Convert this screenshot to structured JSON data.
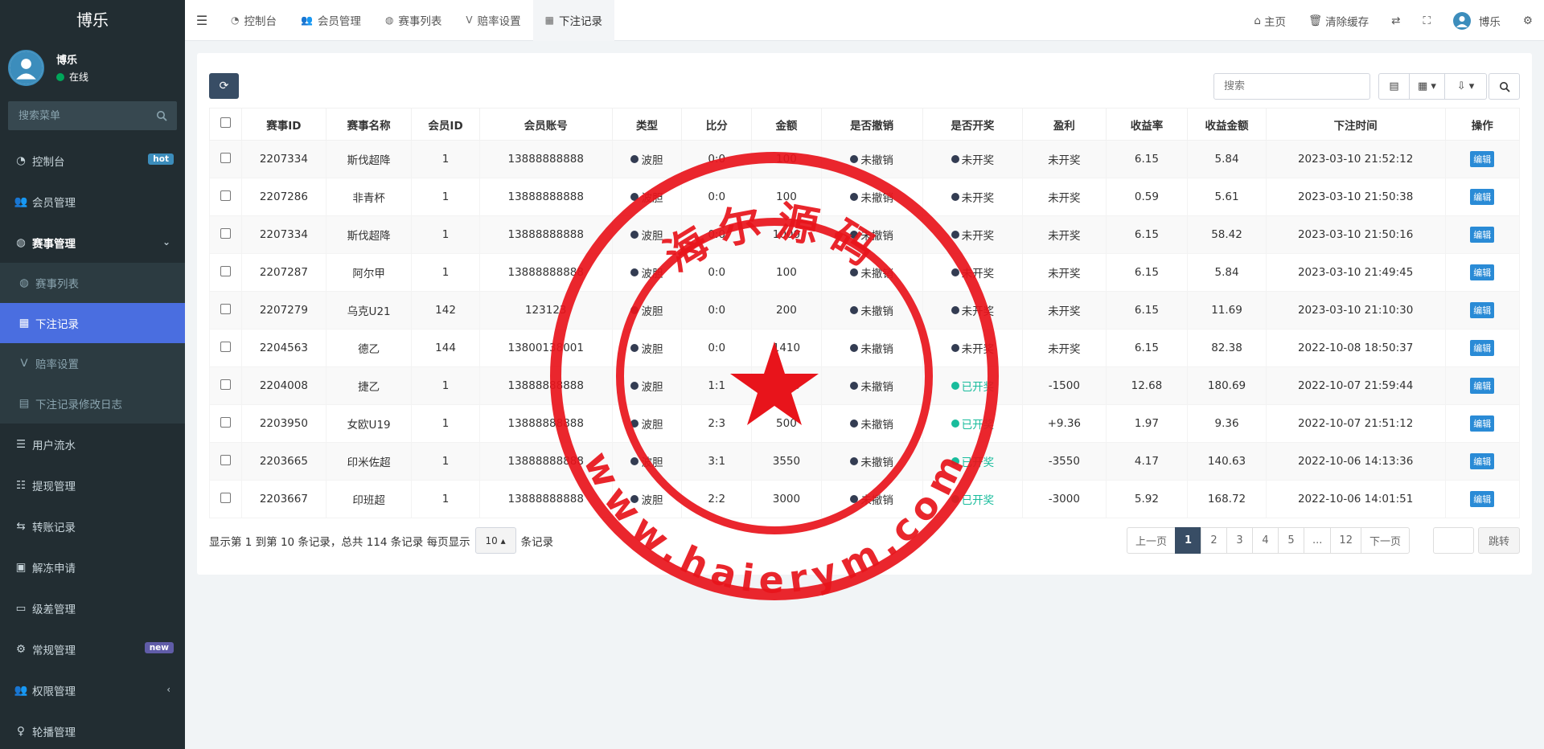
{
  "sidebar": {
    "brand": "博乐",
    "user": {
      "name": "博乐",
      "status": "在线"
    },
    "search_placeholder": "搜索菜单",
    "items": [
      {
        "label": "控制台",
        "icon": "dashboard-icon",
        "badge": "hot"
      },
      {
        "label": "会员管理",
        "icon": "users-icon"
      },
      {
        "label": "赛事管理",
        "icon": "globe-icon",
        "arrow": "⌄"
      },
      {
        "label": "赛事列表",
        "icon": "globe-icon"
      },
      {
        "label": "下注记录",
        "icon": "calendar-icon"
      },
      {
        "label": "赔率设置",
        "icon": "vk-icon"
      },
      {
        "label": "下注记录修改日志",
        "icon": "list-icon"
      },
      {
        "label": "用户流水",
        "icon": "bars-icon"
      },
      {
        "label": "提现管理",
        "icon": "list-ol-icon"
      },
      {
        "label": "转账记录",
        "icon": "transfer-icon"
      },
      {
        "label": "解冻申请",
        "icon": "picture-icon"
      },
      {
        "label": "级差管理",
        "icon": "window-icon"
      },
      {
        "label": "常规管理",
        "icon": "cogs-icon",
        "badge": "new"
      },
      {
        "label": "权限管理",
        "icon": "users-icon",
        "arrow": "‹"
      },
      {
        "label": "轮播管理",
        "icon": "venus-icon"
      }
    ]
  },
  "topbar": {
    "tabs": [
      {
        "label": "控制台",
        "icon": "dashboard-icon"
      },
      {
        "label": "会员管理",
        "icon": "users-icon"
      },
      {
        "label": "赛事列表",
        "icon": "globe-icon"
      },
      {
        "label": "赔率设置",
        "icon": "vk-icon"
      },
      {
        "label": "下注记录",
        "icon": "calendar-icon"
      }
    ],
    "right": {
      "home": "主页",
      "clear_cache": "清除缓存",
      "username": "博乐"
    }
  },
  "toolbar": {
    "search_placeholder": "搜索"
  },
  "table": {
    "headers": [
      "赛事ID",
      "赛事名称",
      "会员ID",
      "会员账号",
      "类型",
      "比分",
      "金额",
      "是否撤销",
      "是否开奖",
      "盈利",
      "收益率",
      "收益金额",
      "下注时间",
      "操作"
    ],
    "rows": [
      [
        "2207334",
        "斯伐超降",
        "1",
        "13888888888",
        "波胆",
        "0:0",
        "100",
        "未撤销",
        "未开奖",
        "未开奖",
        "6.15",
        "5.84",
        "2023-03-10 21:52:12",
        "编辑"
      ],
      [
        "2207286",
        "非青杯",
        "1",
        "13888888888",
        "波胆",
        "0:0",
        "100",
        "未撤销",
        "未开奖",
        "未开奖",
        "0.59",
        "5.61",
        "2023-03-10 21:50:38",
        "编辑"
      ],
      [
        "2207334",
        "斯伐超降",
        "1",
        "13888888888",
        "波胆",
        "0:0",
        "1000",
        "未撤销",
        "未开奖",
        "未开奖",
        "6.15",
        "58.42",
        "2023-03-10 21:50:16",
        "编辑"
      ],
      [
        "2207287",
        "阿尔甲",
        "1",
        "13888888888",
        "波胆",
        "0:0",
        "100",
        "未撤销",
        "未开奖",
        "未开奖",
        "6.15",
        "5.84",
        "2023-03-10 21:49:45",
        "编辑"
      ],
      [
        "2207279",
        "乌克U21",
        "142",
        "123123",
        "波胆",
        "0:0",
        "200",
        "未撤销",
        "未开奖",
        "未开奖",
        "6.15",
        "11.69",
        "2023-03-10 21:10:30",
        "编辑"
      ],
      [
        "2204563",
        "德乙",
        "144",
        "13800138001",
        "波胆",
        "0:0",
        "1410",
        "未撤销",
        "未开奖",
        "未开奖",
        "6.15",
        "82.38",
        "2022-10-08 18:50:37",
        "编辑"
      ],
      [
        "2204008",
        "捷乙",
        "1",
        "13888888888",
        "波胆",
        "1:1",
        "1500",
        "未撤销",
        "已开奖",
        "-1500",
        "12.68",
        "180.69",
        "2022-10-07 21:59:44",
        "编辑"
      ],
      [
        "2203950",
        "女欧U19",
        "1",
        "13888888888",
        "波胆",
        "2:3",
        "500",
        "未撤销",
        "已开奖",
        "+9.36",
        "1.97",
        "9.36",
        "2022-10-07 21:51:12",
        "编辑"
      ],
      [
        "2203665",
        "印米佐超",
        "1",
        "13888888888",
        "波胆",
        "3:1",
        "3550",
        "未撤销",
        "已开奖",
        "-3550",
        "4.17",
        "140.63",
        "2022-10-06 14:13:36",
        "编辑"
      ],
      [
        "2203667",
        "印班超",
        "1",
        "13888888888",
        "波胆",
        "2:2",
        "3000",
        "未撤销",
        "已开奖",
        "-3000",
        "5.92",
        "168.72",
        "2022-10-06 14:01:51",
        "编辑"
      ]
    ]
  },
  "pagination": {
    "info_prefix": "显示第 1 到第 10 条记录，总共 114 条记录 每页显示",
    "page_size": "10",
    "info_suffix": "条记录",
    "prev": "上一页",
    "pages": [
      "1",
      "2",
      "3",
      "4",
      "5",
      "...",
      "12"
    ],
    "next": "下一页",
    "jump": "跳转"
  },
  "watermark": {
    "top_text": "海尔源码",
    "bottom_text": "www.haierym.com",
    "color": "#e8141b"
  },
  "colors": {
    "sidebar_bg": "#222d32",
    "active_menu": "#4a6ee0",
    "primary_dark": "#384d65",
    "success": "#18bc9c",
    "edit_button": "#2a8bd6"
  }
}
